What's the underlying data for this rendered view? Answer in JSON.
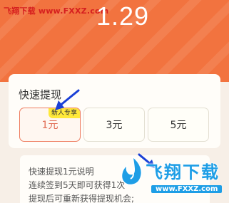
{
  "watermark": {
    "top_text": "飞翔下载 www.FXXZ.com",
    "logo_text": "飞翔下载",
    "logo_url": "www.FXXZ.com"
  },
  "header": {
    "balance": "1.29",
    "accent_color": "#f2733f"
  },
  "withdraw": {
    "title": "快速提现",
    "options": [
      {
        "label": "1元",
        "badge": "新人专享",
        "selected": true
      },
      {
        "label": "3元",
        "selected": false
      },
      {
        "label": "5元",
        "selected": false
      }
    ]
  },
  "info": {
    "title": "快速提现1元说明",
    "line1": "连续签到5天即可获得1次",
    "line2": "提现后可重新获得提现机会;"
  },
  "icons": [
    "arrow-icon",
    "logo-icon"
  ]
}
